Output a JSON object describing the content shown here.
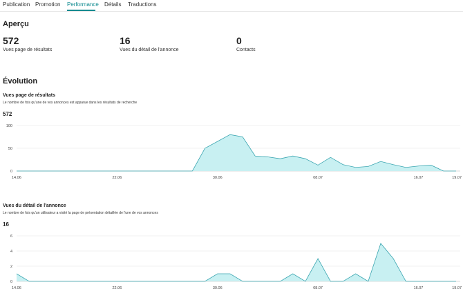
{
  "tabs": [
    {
      "label": "Publication"
    },
    {
      "label": "Promotion"
    },
    {
      "label": "Performance",
      "active": true
    },
    {
      "label": "Détails"
    },
    {
      "label": "Traductions"
    }
  ],
  "accent_color": "#0e8a8f",
  "overview": {
    "title": "Aperçu",
    "metrics": [
      {
        "value": "572",
        "label": "Vues page de résultats"
      },
      {
        "value": "16",
        "label": "Vues du détail de l'annonce"
      },
      {
        "value": "0",
        "label": "Contacts"
      }
    ]
  },
  "evolution_title": "Évolution",
  "chart_data": [
    {
      "type": "area",
      "title": "Vues page de résultats",
      "subtitle": "Le nombre de fois qu'une de vos annonces est apparue dans les résultats de recherche",
      "total": "572",
      "x_tick_labels": [
        "14.06",
        "22.06",
        "30.06",
        "08.07",
        "16.07",
        "19.07"
      ],
      "y_ticks": [
        0,
        50,
        100
      ],
      "ylim": [
        0,
        100
      ],
      "x": [
        "14.06",
        "15.06",
        "16.06",
        "17.06",
        "18.06",
        "19.06",
        "20.06",
        "21.06",
        "22.06",
        "23.06",
        "24.06",
        "25.06",
        "26.06",
        "27.06",
        "28.06",
        "29.06",
        "30.06",
        "01.07",
        "02.07",
        "03.07",
        "04.07",
        "05.07",
        "06.07",
        "07.07",
        "08.07",
        "09.07",
        "10.07",
        "11.07",
        "12.07",
        "13.07",
        "14.07",
        "15.07",
        "16.07",
        "17.07",
        "18.07",
        "19.07"
      ],
      "values": [
        0,
        0,
        0,
        0,
        0,
        0,
        0,
        0,
        0,
        0,
        0,
        0,
        0,
        0,
        0,
        50,
        65,
        80,
        75,
        33,
        31,
        27,
        33,
        27,
        13,
        30,
        14,
        8,
        10,
        21,
        14,
        8,
        11,
        13,
        0,
        0
      ],
      "fill_color": "#c8f0f2",
      "line_color": "#3aa5b0"
    },
    {
      "type": "area",
      "title": "Vues du détail de l'annonce",
      "subtitle": "Le nombre de fois qu'un utilisateur a visité la page de présentation détaillée de l'une de vos annonces",
      "total": "16",
      "x_tick_labels": [
        "14.06",
        "22.06",
        "30.06",
        "08.07",
        "16.07",
        "19.07"
      ],
      "y_ticks": [
        0,
        2,
        4,
        6
      ],
      "ylim": [
        0,
        6
      ],
      "x": [
        "14.06",
        "15.06",
        "16.06",
        "17.06",
        "18.06",
        "19.06",
        "20.06",
        "21.06",
        "22.06",
        "23.06",
        "24.06",
        "25.06",
        "26.06",
        "27.06",
        "28.06",
        "29.06",
        "30.06",
        "01.07",
        "02.07",
        "03.07",
        "04.07",
        "05.07",
        "06.07",
        "07.07",
        "08.07",
        "09.07",
        "10.07",
        "11.07",
        "12.07",
        "13.07",
        "14.07",
        "15.07",
        "16.07",
        "17.07",
        "18.07",
        "19.07"
      ],
      "values": [
        1,
        0,
        0,
        0,
        0,
        0,
        0,
        0,
        0,
        0,
        0,
        0,
        0,
        0,
        0,
        0,
        1,
        1,
        0,
        0,
        0,
        0,
        1,
        0,
        3,
        0,
        0,
        1,
        0,
        5,
        3,
        0,
        0,
        0,
        0,
        0
      ],
      "fill_color": "#c8f0f2",
      "line_color": "#3aa5b0"
    }
  ]
}
